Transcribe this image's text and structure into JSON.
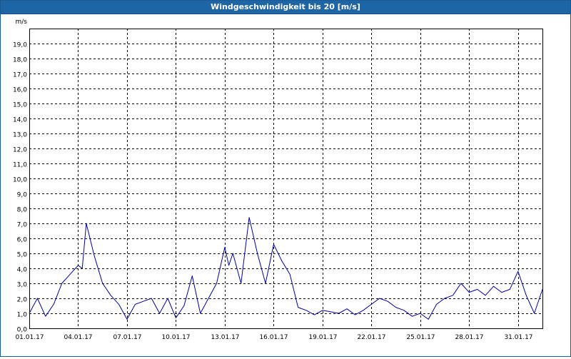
{
  "window": {
    "title": "Windgeschwindigkeit bis 20 [m/s]"
  },
  "colors": {
    "titlebar": "#1e65a6",
    "series": "#0000a0",
    "grid": "#000000"
  },
  "chart_data": {
    "type": "line",
    "title": "Windgeschwindigkeit bis 20 [m/s]",
    "ylabel": "m/s",
    "xlabel": "",
    "ylim": [
      0,
      20
    ],
    "yticks": [
      0.0,
      1.0,
      2.0,
      3.0,
      4.0,
      5.0,
      6.0,
      7.0,
      8.0,
      9.0,
      10.0,
      11.0,
      12.0,
      13.0,
      14.0,
      15.0,
      16.0,
      17.0,
      18.0,
      19.0
    ],
    "ytick_labels": [
      "0,0",
      "1,0",
      "2,0",
      "3,0",
      "4,0",
      "5,0",
      "6,0",
      "7,0",
      "8,0",
      "9,0",
      "10,0",
      "11,0",
      "12,0",
      "13,0",
      "14,0",
      "15,0",
      "16,0",
      "17,0",
      "18,0",
      "19,0"
    ],
    "xlim": [
      "2017-01-01",
      "2017-02-01T12:00"
    ],
    "xticks": [
      "2017-01-01",
      "2017-01-04",
      "2017-01-07",
      "2017-01-10",
      "2017-01-13",
      "2017-01-16",
      "2017-01-19",
      "2017-01-22",
      "2017-01-25",
      "2017-01-28",
      "2017-01-31"
    ],
    "xtick_labels": [
      "01.01.17",
      "04.01.17",
      "07.01.17",
      "10.01.17",
      "13.01.17",
      "16.01.17",
      "19.01.17",
      "22.01.17",
      "25.01.17",
      "28.01.17",
      "31.01.17"
    ],
    "grid": true,
    "grid_style": "dashed",
    "series": [
      {
        "color": "#0000a0",
        "x": [
          "2017-01-01T00:00",
          "2017-01-01T12:00",
          "2017-01-02T00:00",
          "2017-01-02T12:00",
          "2017-01-03T00:00",
          "2017-01-03T12:00",
          "2017-01-04T00:00",
          "2017-01-04T06:00",
          "2017-01-04T12:00",
          "2017-01-05T00:00",
          "2017-01-05T12:00",
          "2017-01-06T00:00",
          "2017-01-06T12:00",
          "2017-01-07T00:00",
          "2017-01-07T12:00",
          "2017-01-08T00:00",
          "2017-01-08T12:00",
          "2017-01-09T00:00",
          "2017-01-09T12:00",
          "2017-01-10T00:00",
          "2017-01-10T12:00",
          "2017-01-11T00:00",
          "2017-01-11T12:00",
          "2017-01-12T00:00",
          "2017-01-12T12:00",
          "2017-01-13T00:00",
          "2017-01-13T06:00",
          "2017-01-13T12:00",
          "2017-01-14T00:00",
          "2017-01-14T12:00",
          "2017-01-15T00:00",
          "2017-01-15T12:00",
          "2017-01-16T00:00",
          "2017-01-16T12:00",
          "2017-01-17T00:00",
          "2017-01-17T12:00",
          "2017-01-18T00:00",
          "2017-01-18T12:00",
          "2017-01-19T00:00",
          "2017-01-19T12:00",
          "2017-01-20T00:00",
          "2017-01-20T12:00",
          "2017-01-21T00:00",
          "2017-01-21T12:00",
          "2017-01-22T00:00",
          "2017-01-22T12:00",
          "2017-01-23T00:00",
          "2017-01-23T12:00",
          "2017-01-24T00:00",
          "2017-01-24T12:00",
          "2017-01-25T00:00",
          "2017-01-25T12:00",
          "2017-01-26T00:00",
          "2017-01-26T12:00",
          "2017-01-27T00:00",
          "2017-01-27T12:00",
          "2017-01-28T00:00",
          "2017-01-28T12:00",
          "2017-01-29T00:00",
          "2017-01-29T12:00",
          "2017-01-30T00:00",
          "2017-01-30T12:00",
          "2017-01-31T00:00",
          "2017-01-31T12:00",
          "2017-02-01T00:00",
          "2017-02-01T12:00"
        ],
        "y": [
          1.0,
          2.0,
          0.8,
          1.6,
          3.0,
          3.6,
          4.2,
          4.0,
          7.0,
          4.8,
          3.0,
          2.2,
          1.6,
          0.6,
          1.6,
          1.8,
          2.0,
          1.0,
          2.0,
          0.7,
          1.5,
          3.5,
          1.0,
          2.0,
          3.0,
          5.4,
          4.2,
          5.0,
          3.0,
          7.4,
          5.0,
          3.0,
          5.6,
          4.5,
          3.6,
          1.4,
          1.2,
          0.9,
          1.2,
          1.1,
          1.0,
          1.3,
          0.9,
          1.2,
          1.6,
          2.0,
          1.8,
          1.4,
          1.2,
          0.8,
          1.0,
          0.6,
          1.6,
          2.0,
          2.2,
          3.0,
          2.4,
          2.6,
          2.2,
          2.8,
          2.4,
          2.6,
          3.8,
          2.2,
          1.0,
          2.6
        ]
      }
    ]
  }
}
